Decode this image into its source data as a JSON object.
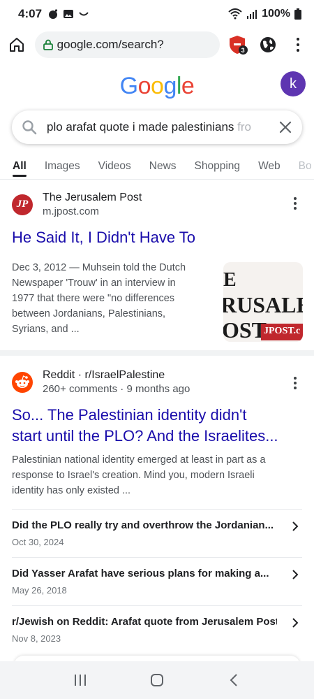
{
  "status_bar": {
    "time": "4:07",
    "battery": "100%"
  },
  "browser": {
    "url": "google.com/search?",
    "shield_badge_count": "3"
  },
  "google": {
    "logo_letters": [
      {
        "char": "G",
        "color": "#4285F4"
      },
      {
        "char": "o",
        "color": "#EA4335"
      },
      {
        "char": "o",
        "color": "#FBBC05"
      },
      {
        "char": "g",
        "color": "#4285F4"
      },
      {
        "char": "l",
        "color": "#34A853"
      },
      {
        "char": "e",
        "color": "#EA4335"
      }
    ],
    "avatar_letter": "k",
    "avatar_color": "#5e35b1"
  },
  "search": {
    "query_visible": "plo arafat quote i made palestinians ",
    "query_faded": "fro"
  },
  "tabs": [
    {
      "label": "All",
      "active": true
    },
    {
      "label": "Images"
    },
    {
      "label": "Videos"
    },
    {
      "label": "News"
    },
    {
      "label": "Shopping"
    },
    {
      "label": "Web"
    },
    {
      "label": "Bo"
    }
  ],
  "results": [
    {
      "source_name": "The Jerusalem Post",
      "source_url": "m.jpost.com",
      "favicon_text": "JP",
      "favicon_color": "#c0272d",
      "title": "He Said It, I Didn't Have To",
      "snippet_lines": [
        "Dec 3, 2012 — Muhsein told the Dutch",
        "Newspaper 'Trouw' in an interview in",
        "1977 that there were \"no differences",
        "between Jordanians, Palestinians,",
        "Syrians, and ..."
      ],
      "thumbnail": {
        "line1": "E",
        "line2": "RUSALE",
        "line3": "OST",
        "badge": "JPOST.c"
      }
    },
    {
      "source_name": "Reddit · r/IsraelPalestine",
      "source_url": "260+ comments · 9 months ago",
      "favicon_color": "#ff4500",
      "title_lines": [
        "So... The Palestinian identity didn't",
        "start until the PLO? And the Israelites..."
      ],
      "snippet_lines": [
        "Palestinian national identity emerged at least in part as a",
        "response to Israel's creation. Mind you, modern Israeli",
        "identity has only existed ..."
      ],
      "sub_results": [
        {
          "title": "Did the PLO really try and overthrow the Jordanian...",
          "date": "Oct 30, 2024"
        },
        {
          "title": "Did Yasser Arafat have serious plans for making a...",
          "date": "May 26, 2018"
        },
        {
          "title": "r/Jewish on Reddit: Arafat quote from Jerusalem Post,...",
          "date": "Nov 8, 2023"
        }
      ]
    }
  ],
  "colors": {
    "link": "#1a0dab",
    "snippet": "#4d5156"
  },
  "icons": {
    "home": "home-icon",
    "lock": "lock-icon",
    "shield": "shield-icon",
    "globe": "globe-icon",
    "search": "search-icon",
    "clear": "close-icon",
    "recents": "recents-icon",
    "home_nav": "home-nav-icon",
    "back": "back-icon"
  }
}
